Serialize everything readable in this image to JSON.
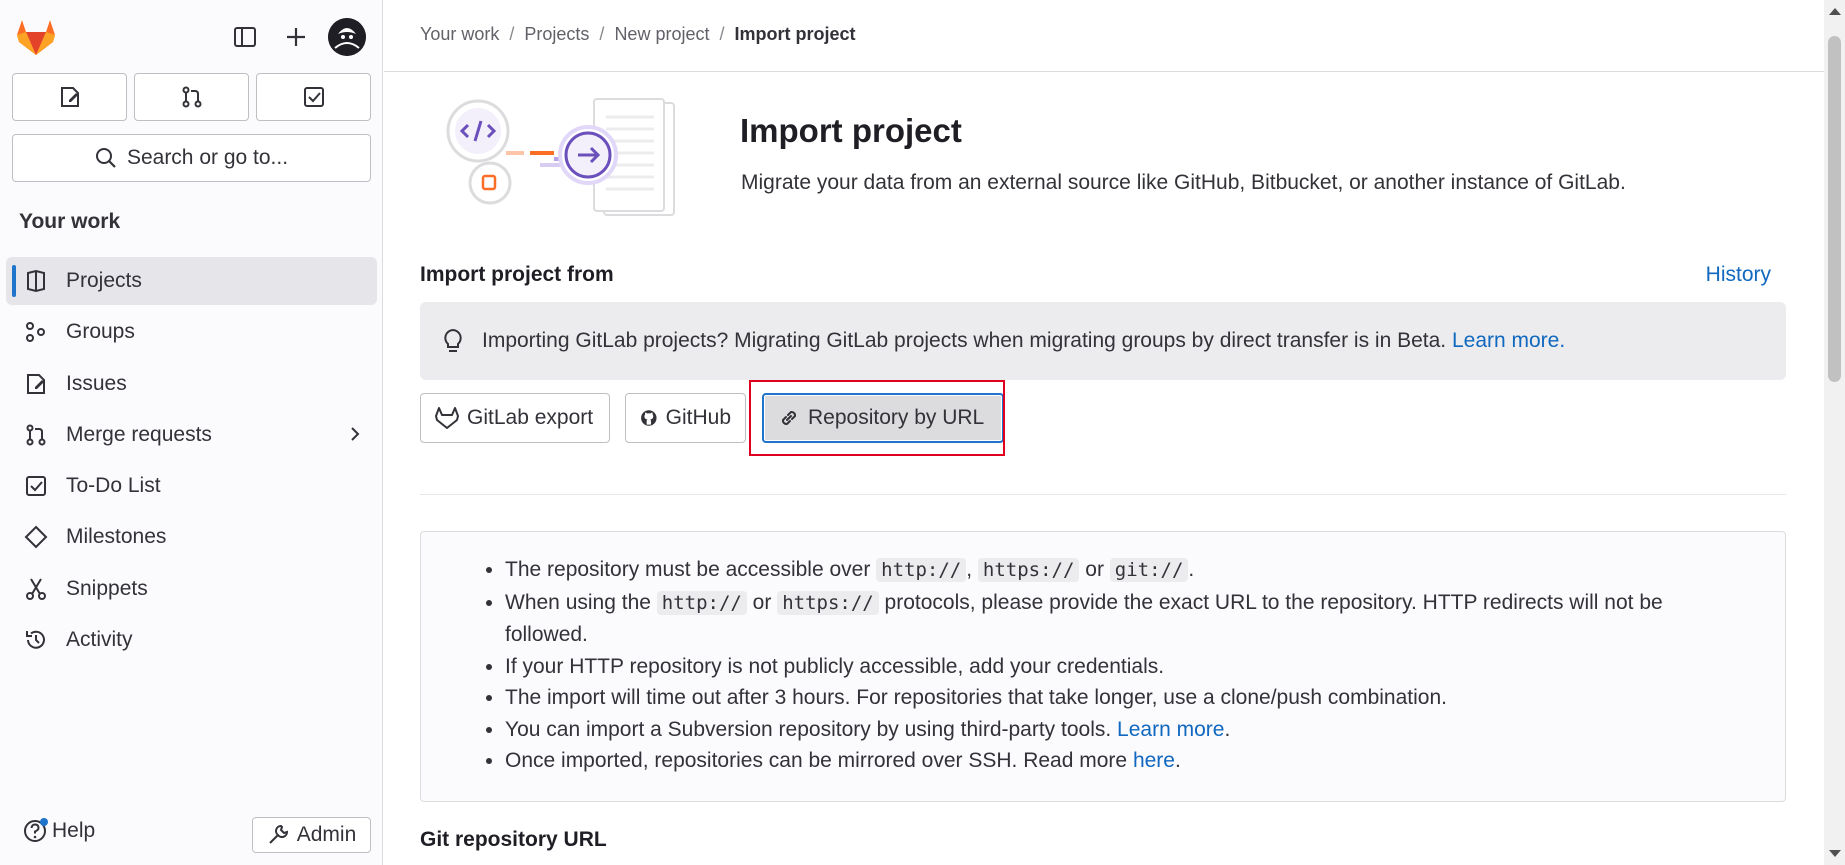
{
  "sidebar": {
    "search_placeholder": "Search or go to...",
    "section_title": "Your work",
    "items": [
      {
        "label": "Projects",
        "icon": "project-icon",
        "active": true
      },
      {
        "label": "Groups",
        "icon": "group-icon"
      },
      {
        "label": "Issues",
        "icon": "issues-icon"
      },
      {
        "label": "Merge requests",
        "icon": "merge-request-icon"
      },
      {
        "label": "To-Do List",
        "icon": "todo-icon"
      },
      {
        "label": "Milestones",
        "icon": "milestone-icon"
      },
      {
        "label": "Snippets",
        "icon": "snippet-icon"
      },
      {
        "label": "Activity",
        "icon": "history-icon"
      }
    ],
    "help_label": "Help",
    "admin_label": "Admin"
  },
  "breadcrumb": {
    "items": [
      "Your work",
      "Projects",
      "New project",
      "Import project"
    ],
    "separator": "/"
  },
  "header": {
    "title": "Import project",
    "subtitle": "Migrate your data from an external source like GitHub, Bitbucket, or another instance of GitLab."
  },
  "import": {
    "section_label": "Import project from",
    "history_link": "History",
    "alert_text": "Importing GitLab projects? Migrating GitLab projects when migrating groups by direct transfer is in Beta.",
    "alert_link": "Learn more.",
    "sources": [
      {
        "label": "GitLab export",
        "icon": "tanuki-icon"
      },
      {
        "label": "GitHub",
        "icon": "github-icon"
      },
      {
        "label": "Repository by URL",
        "icon": "link-icon",
        "selected": true
      }
    ]
  },
  "info": {
    "l1_a": "The repository must be accessible over ",
    "l1_c1": "http://",
    "l1_sep": ", ",
    "l1_c2": "https://",
    "l1_or": " or ",
    "l1_c3": "git://",
    "l1_end": ".",
    "l2_a": "When using the ",
    "l2_c1": "http://",
    "l2_or": " or ",
    "l2_c2": "https://",
    "l2_b": " protocols, please provide the exact URL to the repository. HTTP redirects will not be followed.",
    "l3": "If your HTTP repository is not publicly accessible, add your credentials.",
    "l4": "The import will time out after 3 hours. For repositories that take longer, use a clone/push combination.",
    "l5_a": "You can import a Subversion repository by using third-party tools. ",
    "l5_link": "Learn more",
    "l5_end": ".",
    "l6_a": "Once imported, repositories can be mirrored over SSH. Read more ",
    "l6_link": "here",
    "l6_end": "."
  },
  "form": {
    "git_url_label": "Git repository URL"
  },
  "colors": {
    "link": "#1068bf",
    "active_indicator": "#1f75cb",
    "highlight_box": "#e0001f",
    "brand_orange": "#fc6d26",
    "brand_purple": "#6b4fbb"
  }
}
